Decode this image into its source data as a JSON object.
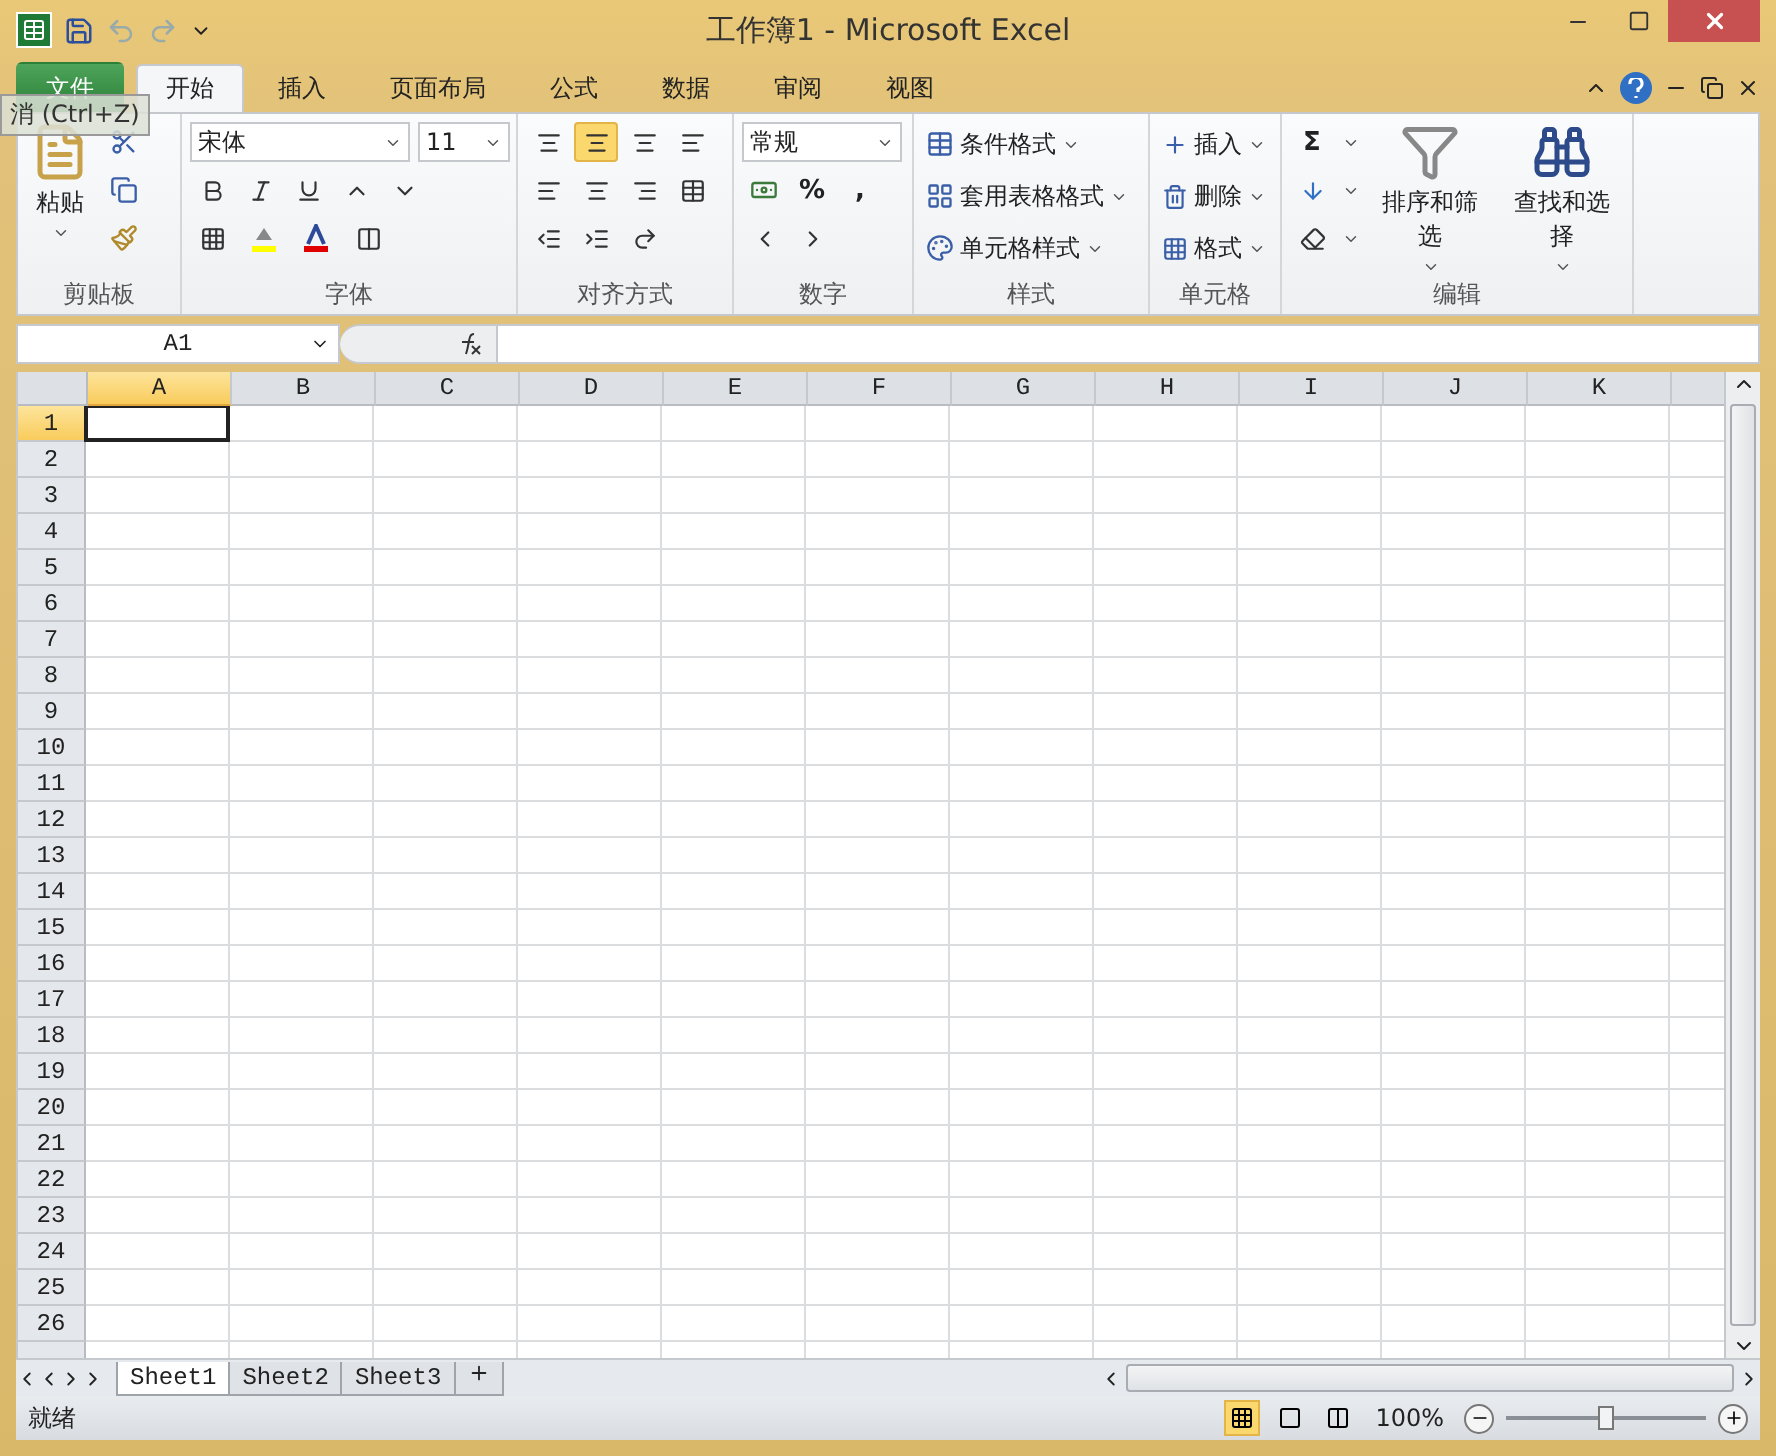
{
  "title_bar": {
    "title": "工作簿1 - Microsoft Excel"
  },
  "tooltip": {
    "text": "消 (Ctrl+Z)"
  },
  "tabs": [
    {
      "label": "文件",
      "kind": "file",
      "selected": false
    },
    {
      "label": "开始",
      "kind": "tab",
      "selected": true
    },
    {
      "label": "插入",
      "kind": "tab",
      "selected": false
    },
    {
      "label": "页面布局",
      "kind": "tab",
      "selected": false
    },
    {
      "label": "公式",
      "kind": "tab",
      "selected": false
    },
    {
      "label": "数据",
      "kind": "tab",
      "selected": false
    },
    {
      "label": "审阅",
      "kind": "tab",
      "selected": false
    },
    {
      "label": "视图",
      "kind": "tab",
      "selected": false
    }
  ],
  "ribbon": {
    "clipboard": {
      "paste": "粘贴",
      "label": "剪贴板"
    },
    "font": {
      "name": "宋体",
      "size": "11",
      "label": "字体"
    },
    "alignment": {
      "vertical": [
        {
          "selected": false
        },
        {
          "selected": true
        },
        {
          "selected": false
        }
      ],
      "label": "对齐方式"
    },
    "number": {
      "format": "常规",
      "percent": "%",
      "comma": ",",
      "label": "数字"
    },
    "styles": {
      "items": [
        "条件格式",
        "套用表格格式",
        "单元格样式"
      ],
      "label": "样式"
    },
    "cells": {
      "items": [
        "插入",
        "删除",
        "格式"
      ],
      "label": "单元格"
    },
    "editing": {
      "sum": "Σ",
      "items": [
        "排序和筛选",
        "查找和选择"
      ],
      "label": "编辑"
    }
  },
  "formula_bar": {
    "name_box": "A1"
  },
  "sheet": {
    "columns": [
      {
        "label": "A",
        "selected": true
      },
      {
        "label": "B",
        "selected": false
      },
      {
        "label": "C",
        "selected": false
      },
      {
        "label": "D",
        "selected": false
      },
      {
        "label": "E",
        "selected": false
      },
      {
        "label": "F",
        "selected": false
      },
      {
        "label": "G",
        "selected": false
      },
      {
        "label": "H",
        "selected": false
      },
      {
        "label": "I",
        "selected": false
      },
      {
        "label": "J",
        "selected": false
      },
      {
        "label": "K",
        "selected": false
      }
    ],
    "rows": [
      {
        "label": "1",
        "selected": true
      },
      {
        "label": "2",
        "selected": false
      },
      {
        "label": "3",
        "selected": false
      },
      {
        "label": "4",
        "selected": false
      },
      {
        "label": "5",
        "selected": false
      },
      {
        "label": "6",
        "selected": false
      },
      {
        "label": "7",
        "selected": false
      },
      {
        "label": "8",
        "selected": false
      },
      {
        "label": "9",
        "selected": false
      },
      {
        "label": "10",
        "selected": false
      },
      {
        "label": "11",
        "selected": false
      },
      {
        "label": "12",
        "selected": false
      },
      {
        "label": "13",
        "selected": false
      },
      {
        "label": "14",
        "selected": false
      },
      {
        "label": "15",
        "selected": false
      },
      {
        "label": "16",
        "selected": false
      },
      {
        "label": "17",
        "selected": false
      },
      {
        "label": "18",
        "selected": false
      },
      {
        "label": "19",
        "selected": false
      },
      {
        "label": "20",
        "selected": false
      },
      {
        "label": "21",
        "selected": false
      },
      {
        "label": "22",
        "selected": false
      },
      {
        "label": "23",
        "selected": false
      },
      {
        "label": "24",
        "selected": false
      },
      {
        "label": "25",
        "selected": false
      },
      {
        "label": "26",
        "selected": false
      }
    ]
  },
  "sheet_tabs": [
    {
      "label": "Sheet1",
      "selected": true
    },
    {
      "label": "Sheet2",
      "selected": false
    },
    {
      "label": "Sheet3",
      "selected": false
    }
  ],
  "status_bar": {
    "status": "就绪",
    "views": [
      {
        "selected": true
      },
      {
        "selected": false
      },
      {
        "selected": false
      }
    ],
    "zoom": "100%",
    "zoom_slider": {
      "level": 0.5
    }
  }
}
